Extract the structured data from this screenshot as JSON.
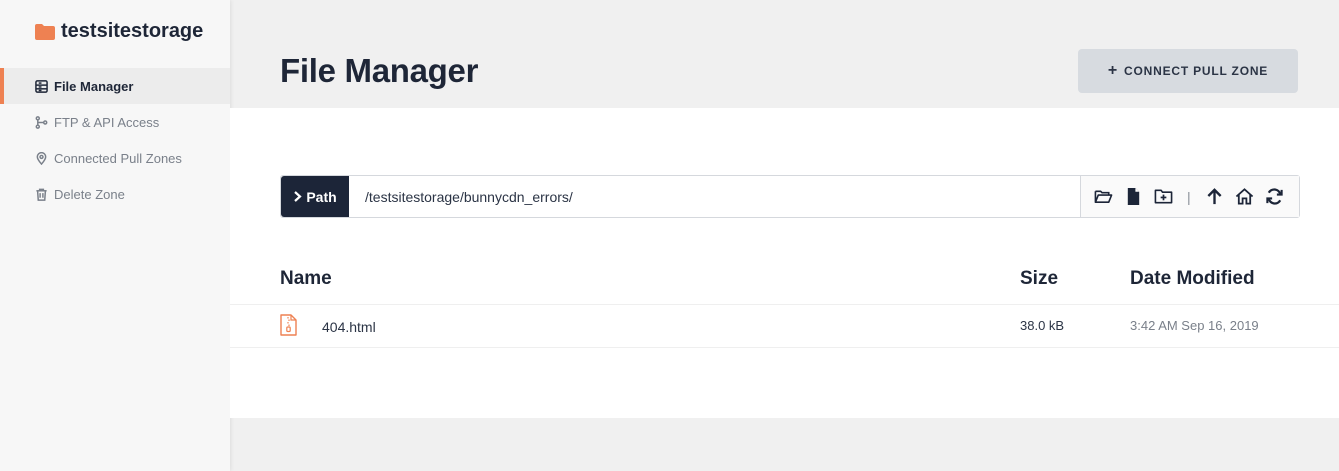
{
  "sidebar": {
    "zone_name": "testsitestorage",
    "items": [
      {
        "label": "File Manager",
        "icon": "file-manager-icon",
        "active": true
      },
      {
        "label": "FTP & API Access",
        "icon": "git-branch-icon",
        "active": false
      },
      {
        "label": "Connected Pull Zones",
        "icon": "map-pin-icon",
        "active": false
      },
      {
        "label": "Delete Zone",
        "icon": "trash-icon",
        "active": false
      }
    ]
  },
  "header": {
    "title": "File Manager",
    "connect_button": "CONNECT PULL ZONE"
  },
  "path_bar": {
    "label": "Path",
    "value": "/testsitestorage/bunnycdn_errors/",
    "separator": "|",
    "tools": [
      "open-folder-icon",
      "new-file-icon",
      "new-folder-icon",
      "up-arrow-icon",
      "home-icon",
      "refresh-icon"
    ]
  },
  "table": {
    "headers": {
      "name": "Name",
      "size": "Size",
      "date": "Date Modified"
    },
    "rows": [
      {
        "name": "404.html",
        "size": "38.0 kB",
        "date": "3:42 AM Sep 16, 2019"
      }
    ]
  },
  "colors": {
    "accent": "#ee8152",
    "navy": "#1c2538",
    "button_bg": "#d7dbe0"
  }
}
